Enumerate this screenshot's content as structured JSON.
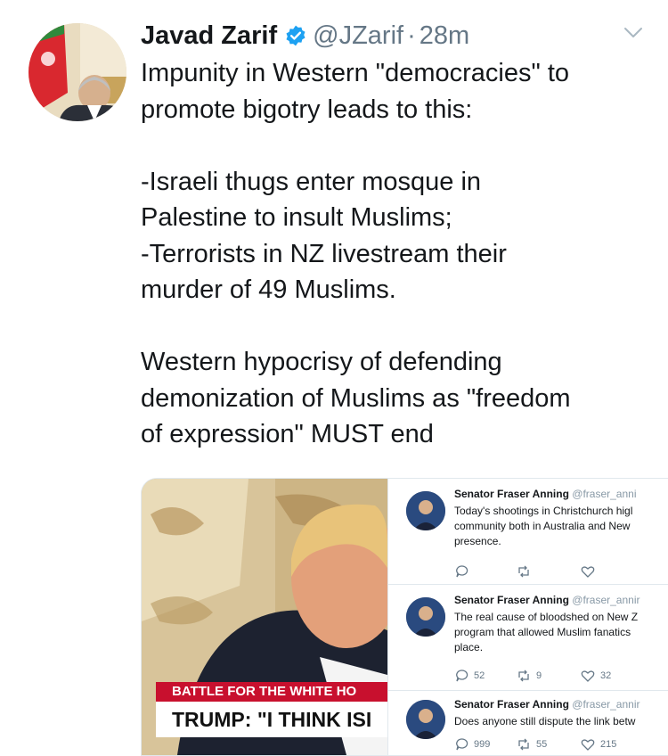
{
  "tweet": {
    "author_name": "Javad Zarif",
    "handle": "@JZarif",
    "separator": "·",
    "time": "28m",
    "lines": [
      "Impunity in Western \"democracies\" to",
      "promote bigotry leads to this:",
      "",
      "-Israeli thugs enter mosque in",
      "Palestine to insult Muslims;",
      "-Terrorists in NZ livestream their",
      "murder of 49 Muslims.",
      "",
      "Western hypocrisy of defending",
      "demonization of Muslims as \"freedom",
      "of expression\" MUST end"
    ]
  },
  "media": {
    "banner_top": "BATTLE FOR THE WHITE HO",
    "banner_bottom": "TRUMP: \"I THINK ISI",
    "embedded_tweets": [
      {
        "name": "Senator Fraser Anning",
        "handle": "@fraser_anni",
        "lines": [
          "Today's shootings in Christchurch higl",
          "community both in Australia and New",
          "presence."
        ],
        "replies": "",
        "retweets": "",
        "likes": ""
      },
      {
        "name": "Senator Fraser Anning",
        "handle": "@fraser_annir",
        "lines": [
          "The real cause of bloodshed on New Z",
          "program that allowed Muslim fanatics",
          "place."
        ],
        "replies": "52",
        "retweets": "9",
        "likes": "32"
      },
      {
        "name": "Senator Fraser Anning",
        "handle": "@fraser_annir",
        "lines": [
          "Does anyone still dispute the link betw"
        ],
        "replies": "999",
        "retweets": "55",
        "likes": "215"
      }
    ]
  },
  "colors": {
    "verified": "#1da1f2",
    "text": "#14171a",
    "secondary": "#657786",
    "banner_red": "#c8102e"
  }
}
